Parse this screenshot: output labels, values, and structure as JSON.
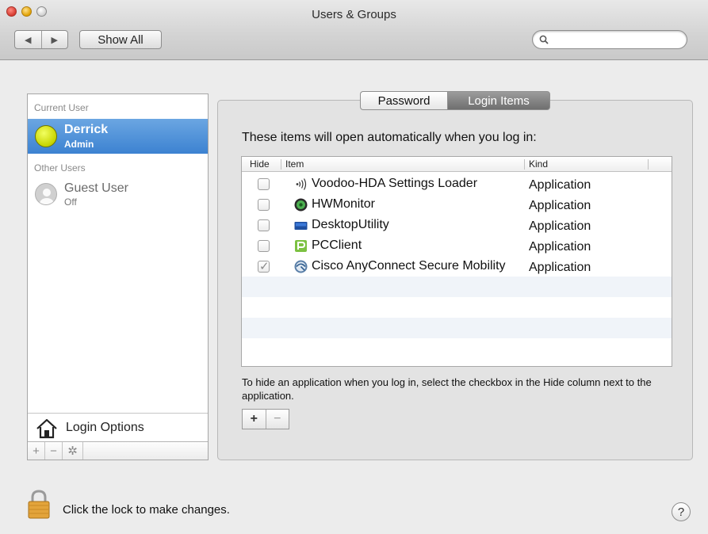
{
  "window": {
    "title": "Users & Groups"
  },
  "toolbar": {
    "back_glyph": "◀",
    "forward_glyph": "▶",
    "show_all_label": "Show All",
    "search_placeholder": ""
  },
  "sidebar": {
    "current_user_header": "Current User",
    "current_user": {
      "name": "Derrick",
      "role": "Admin",
      "avatar_icon": "tennis-ball-icon"
    },
    "other_users_header": "Other Users",
    "other_users": [
      {
        "name": "Guest User",
        "status": "Off",
        "avatar_icon": "guest-avatar-icon"
      }
    ],
    "login_options_label": "Login Options",
    "bottom_buttons": {
      "add": "+",
      "remove": "−",
      "action_icon": "gear-icon"
    }
  },
  "tabs": {
    "password": "Password",
    "login_items": "Login Items",
    "selected": "Login Items"
  },
  "login_items": {
    "intro": "These items will open automatically when you log in:",
    "columns": {
      "hide": "Hide",
      "item": "Item",
      "kind": "Kind"
    },
    "rows": [
      {
        "hidden": false,
        "name": "Voodoo-HDA Settings Loader",
        "kind": "Application",
        "icon": "sound-waves-icon"
      },
      {
        "hidden": false,
        "name": "HWMonitor",
        "kind": "Application",
        "icon": "hwmonitor-icon"
      },
      {
        "hidden": false,
        "name": "DesktopUtility",
        "kind": "Application",
        "icon": "desktop-utility-icon"
      },
      {
        "hidden": false,
        "name": "PCClient",
        "kind": "Application",
        "icon": "pcclient-icon"
      },
      {
        "hidden": true,
        "name": "Cisco AnyConnect Secure Mobility",
        "kind": "Application",
        "icon": "cisco-anyconnect-icon"
      }
    ],
    "hint": "To hide an application when you log in, select the checkbox in the Hide column next to the application.",
    "add_label": "+",
    "remove_label": "−"
  },
  "footer": {
    "lock_text": "Click the lock to make changes.",
    "help_label": "?"
  },
  "colors": {
    "selection": "#3c82d1",
    "tab_selected": "#7f7f7f",
    "lock": "#d99a2e"
  }
}
